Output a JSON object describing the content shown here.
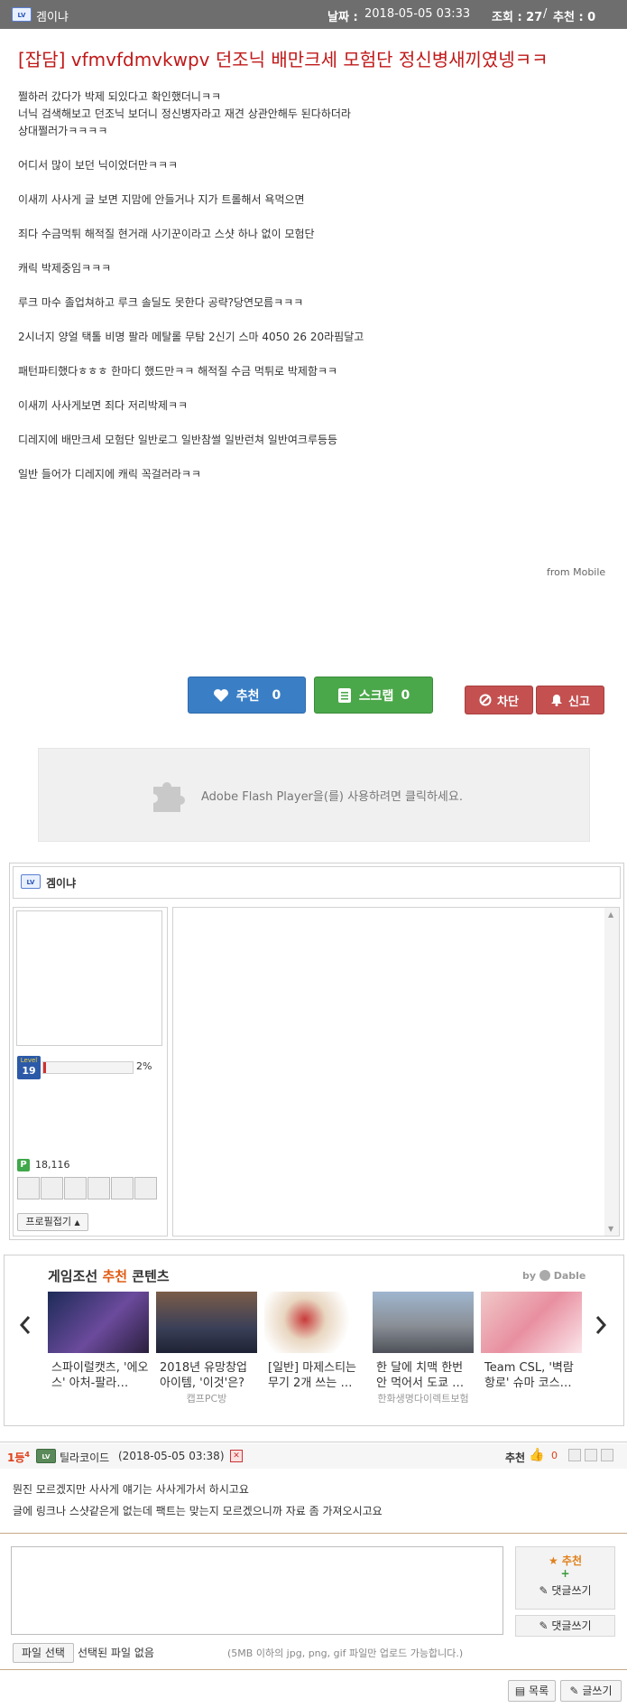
{
  "header": {
    "level_icon": "LV",
    "author": "겜이냐",
    "date_label": "날짜 :",
    "date_value": "2018-05-05 03:33",
    "views_label": "조회 : 27",
    "sep": "/",
    "reco_label": "추천 : 0"
  },
  "post": {
    "title": "[잡담] vfmvfdmvkwpv 던조닉 배만크세 모험단 정신병새끼였넹ㅋㅋ",
    "lines": [
      "쩔하러 갔다가 박제 되있다고 확인했더니ㅋㅋ",
      "너닉 검색해보고 던조닉 보더니 정신병자라고 재견 상관안해두 된다하더라",
      "상대쩔러가ㅋㅋㅋㅋ",
      "",
      "어디서 많이 보던 닉이었더만ㅋㅋㅋ",
      "",
      "이새끼 사사게 글 보면 지맘에 안들거나 지가 트롤해서 욕먹으면",
      "",
      "죄다 수금먹튀 해적질 현거래 사기꾼이라고 스샷 하나 없이 모험단",
      "",
      "캐릭 박제중임ㅋㅋㅋ",
      "",
      "루크 마수 졸업쳐하고 루크 솔딜도 못한다 공략?당연모름ㅋㅋㅋ",
      "",
      "2시너지 양얼 택톨 비명 팔라 메탈롤 무탐 2신기 스마 4050   26 20라핌달고",
      "",
      "패턴파티했다ㅎㅎㅎ 한마디 했드만ㅋㅋ 해적질 수금 먹튀로 박제함ㅋㅋ",
      "",
      "이새끼 사사게보면 죄다 저리박제ㅋㅋ",
      "",
      "디레지에 배만크세 모험단 일반로그 일반참썰 일반런쳐 일반여크루등등",
      "",
      "일반 들어가 디레지에 캐릭 꼭걸러라ㅋㅋ"
    ],
    "from": "from Mobile"
  },
  "actions": {
    "recommend_label": "추천",
    "recommend_count": "0",
    "scrap_label": "스크랩",
    "scrap_count": "0",
    "block_label": "차단",
    "report_label": "신고"
  },
  "flash": {
    "text": "Adobe Flash Player을(를) 사용하려면 클릭하세요."
  },
  "profile": {
    "level_icon": "LV",
    "name": "겜이냐",
    "level_badge_top": "Level",
    "level_num": "19",
    "exp_percent": "2%",
    "exp_fraction": 0.02,
    "points_icon": "P",
    "points": "18,116",
    "fold_label": "프로필접기"
  },
  "recommend": {
    "title_prefix": "게임조선 ",
    "title_accent": "추천",
    "title_suffix": " 콘텐츠",
    "by_label": "by",
    "brand": "Dable",
    "cards": [
      {
        "title": "스파이럴캣츠, '에오스' 아처-팔라…",
        "source": ""
      },
      {
        "title": "2018년 유망창업아이템, '이것'은?",
        "source": "캡프PC방"
      },
      {
        "title": "[일반] 마제스티는 무기 2개 쓰는 …",
        "source": ""
      },
      {
        "title": "한 달에 치맥 한번 안 먹어서 도쿄 …",
        "source": "한화생명다이렉트보험"
      },
      {
        "title": "Team CSL, '벽람항로' 슈마 코스…",
        "source": ""
      }
    ]
  },
  "comment": {
    "rank_prefix": "1등",
    "rank_suffix": "4",
    "level_icon": "LV",
    "author": "틸라코이드",
    "datetime": "(2018-05-05 03:38)",
    "reco_label": "추천",
    "reco_count": "0",
    "line1": "뭔진 모르겠지만 사사게 얘기는 사사게가서 하시고요",
    "line2": "글에 링크나 스샷같은게 없는데 팩트는 맞는지 모르겠으니까 자료 좀 가져오시고요"
  },
  "write": {
    "recommend_label": "추천",
    "write_label": "댓글쓰기",
    "write_label2": "댓글쓰기",
    "file_button": "파일 선택",
    "file_status": "선택된 파일 없음",
    "file_note": "(5MB 이하의 jpg, png, gif 파일만 업로드 가능합니다.)"
  },
  "footer": {
    "list_label": "목록",
    "write_label": "글쓰기"
  }
}
